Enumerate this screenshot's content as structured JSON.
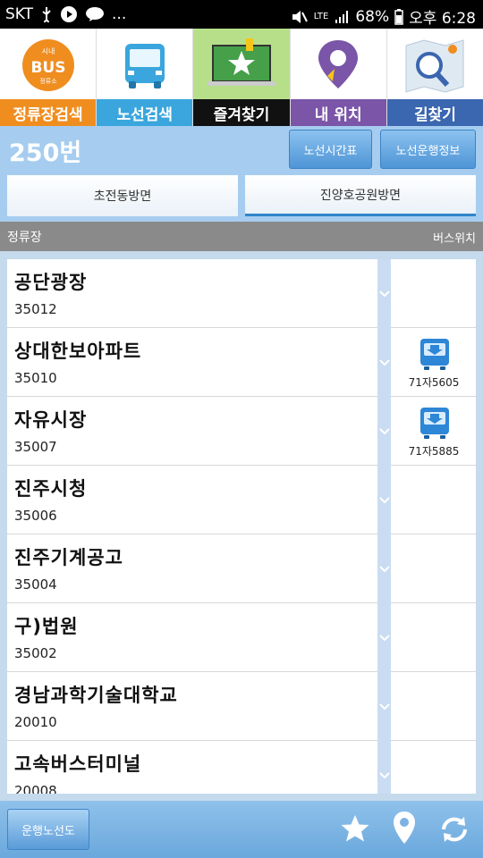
{
  "status_bar": {
    "carrier": "SKT",
    "ellipsis": "...",
    "network": "LTE",
    "battery": "68%",
    "time": "오후 6:28"
  },
  "tabs": [
    {
      "label": "정류장검색",
      "icon": "bus-stop-icon",
      "color": "#f08d1f",
      "active": false,
      "bus_badge": "BUS",
      "badge_top": "시내",
      "badge_bottom": "정류소"
    },
    {
      "label": "노선검색",
      "icon": "bus-icon",
      "color": "#3aa6dd",
      "active": false
    },
    {
      "label": "즐겨찾기",
      "icon": "favorite-monitor-icon",
      "color": "#111111",
      "active": true
    },
    {
      "label": "내 위치",
      "icon": "location-pin-icon",
      "color": "#7a55a8",
      "active": false
    },
    {
      "label": "길찾기",
      "icon": "map-search-icon",
      "color": "#3b66b0",
      "active": false
    }
  ],
  "header": {
    "route": "250번",
    "timetable_button": "노선시간표",
    "route_info_button": "노선운행정보"
  },
  "directions": [
    {
      "label": "초전동방면",
      "active": false
    },
    {
      "label": "진양호공원방면",
      "active": true
    }
  ],
  "columns": {
    "stop": "정류장",
    "bus_location": "버스위치"
  },
  "stops": [
    {
      "name": "공단광장",
      "id": "35012",
      "bus": null
    },
    {
      "name": "상대한보아파트",
      "id": "35010",
      "bus": "71자5605"
    },
    {
      "name": "자유시장",
      "id": "35007",
      "bus": "71자5885"
    },
    {
      "name": "진주시청",
      "id": "35006",
      "bus": null
    },
    {
      "name": "진주기계공고",
      "id": "35004",
      "bus": null
    },
    {
      "name": "구)법원",
      "id": "35002",
      "bus": null
    },
    {
      "name": "경남과학기술대학교",
      "id": "20010",
      "bus": null
    },
    {
      "name": "고속버스터미널",
      "id": "20008",
      "bus": null
    }
  ],
  "bottom_bar": {
    "route_map_button": "운행노선도",
    "icons": [
      "star-icon",
      "location-pin-icon",
      "refresh-icon"
    ]
  }
}
